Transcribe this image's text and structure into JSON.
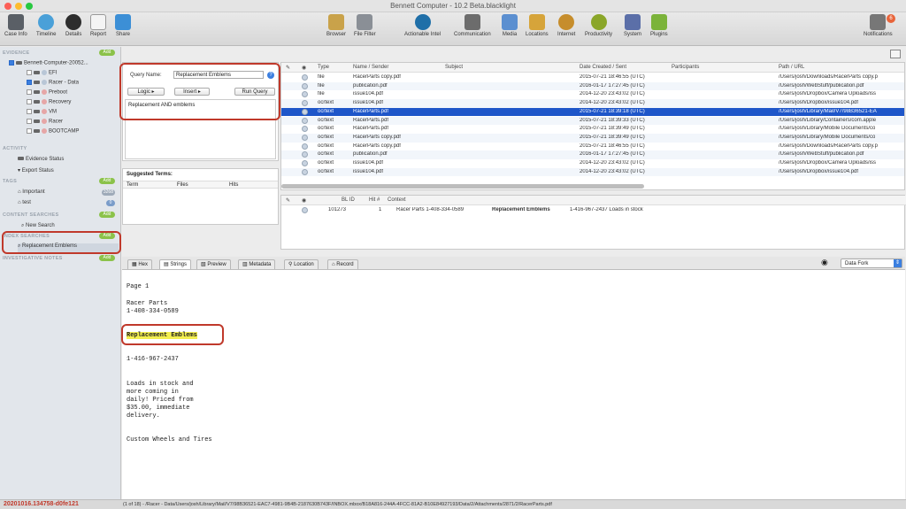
{
  "window": {
    "title": "Bennett Computer - 10.2 Beta.blacklight"
  },
  "toolbar": {
    "left": [
      {
        "label": "Case Info",
        "icon": "briefcase-icon"
      },
      {
        "label": "Timeline",
        "icon": "timeline-icon"
      },
      {
        "label": "Details",
        "icon": "details-icon"
      },
      {
        "label": "Report",
        "icon": "report-icon"
      },
      {
        "label": "Share",
        "icon": "share-icon"
      }
    ],
    "center": [
      {
        "label": "Browser",
        "icon": "browser-icon"
      },
      {
        "label": "File Filter",
        "icon": "file-filter-icon"
      },
      {
        "label": "Actionable Intel",
        "icon": "actionable-intel-icon"
      },
      {
        "label": "Communication",
        "icon": "communication-icon"
      },
      {
        "label": "Media",
        "icon": "media-icon"
      },
      {
        "label": "Locations",
        "icon": "locations-icon"
      },
      {
        "label": "Internet",
        "icon": "internet-icon"
      },
      {
        "label": "Productivity",
        "icon": "productivity-icon"
      },
      {
        "label": "System",
        "icon": "system-icon"
      },
      {
        "label": "Plugins",
        "icon": "plugins-icon"
      }
    ],
    "right": {
      "label": "Notifications",
      "badge": "6"
    }
  },
  "sidebar": {
    "evidence": {
      "title": "EVIDENCE",
      "add": "Add",
      "root": "Bennett-Computer-20052...",
      "items": [
        "EFI",
        "Racer - Data",
        "Preboot",
        "Recovery",
        "VM",
        "Racer",
        "BOOTCAMP"
      ]
    },
    "activity": {
      "title": "ACTIVITY",
      "items": [
        "Evidence Status",
        "Export Status"
      ]
    },
    "tags": {
      "title": "TAGS",
      "add": "Add",
      "items": [
        {
          "label": "Important",
          "count": "3268"
        },
        {
          "label": "test",
          "count": "0"
        }
      ]
    },
    "content": {
      "title": "CONTENT SEARCHES",
      "add": "Add",
      "items": [
        "New Search"
      ]
    },
    "index": {
      "title": "INDEX SEARCHES",
      "add": "Add",
      "items": [
        "Replacement Emblems"
      ]
    },
    "notes": {
      "title": "INVESTIGATIVE NOTES",
      "add": "Add"
    }
  },
  "query": {
    "name_label": "Query Name:",
    "name_value": "Replacement Emblems",
    "logic": "Logic",
    "insert": "Insert",
    "run": "Run Query",
    "text": "Replacement AND emblems",
    "suggested_title": "Suggested Terms:",
    "cols": [
      "Term",
      "Files",
      "Hits"
    ]
  },
  "results": {
    "cols": [
      "Type",
      "Name / Sender",
      "Subject",
      "Date Created / Sent",
      "Participants",
      "Path / URL"
    ],
    "rows": [
      [
        "file",
        "RacerParts copy.pdf",
        "",
        "2015-07-21 18:46:55 (UTC)",
        "",
        "/Users/josh/Downloads/RacerParts copy.p"
      ],
      [
        "file",
        "publication.pdf",
        "",
        "2016-01-17 17:27:45 (UTC)",
        "",
        "/Users/josh/WebStuff/publication.pdf"
      ],
      [
        "file",
        "issue104.pdf",
        "",
        "2014-12-20 23:43:02 (UTC)",
        "",
        "/Users/josh/Dropbox/Camera Uploads/iss"
      ],
      [
        "ocrtext",
        "issue104.pdf",
        "",
        "2014-12-20 23:43:02 (UTC)",
        "",
        "/Users/josh/Dropbox/issue104.pdf"
      ],
      [
        "ocrtext",
        "RacerParts.pdf",
        "",
        "2015-07-21 18:39:18 (UTC)",
        "",
        "/Users/josh/Library/Mail/V7/98B36521-EA"
      ],
      [
        "ocrtext",
        "RacerParts.pdf",
        "",
        "2015-07-21 18:39:33 (UTC)",
        "",
        "/Users/josh/Library/Containers/com.apple"
      ],
      [
        "ocrtext",
        "RacerParts.pdf",
        "",
        "2015-07-21 18:39:49 (UTC)",
        "",
        "/Users/josh/Library/Mobile Documents/co"
      ],
      [
        "ocrtext",
        "RacerParts copy.pdf",
        "",
        "2015-07-21 18:39:49 (UTC)",
        "",
        "/Users/josh/Library/Mobile Documents/co"
      ],
      [
        "ocrtext",
        "RacerParts copy.pdf",
        "",
        "2015-07-21 18:46:55 (UTC)",
        "",
        "/Users/josh/Downloads/RacerParts copy.p"
      ],
      [
        "ocrtext",
        "publication.pdf",
        "",
        "2016-01-17 17:27:45 (UTC)",
        "",
        "/Users/josh/WebStuff/publication.pdf"
      ],
      [
        "ocrtext",
        "issue104.pdf",
        "",
        "2014-12-20 23:43:02 (UTC)",
        "",
        "/Users/josh/Dropbox/Camera Uploads/iss"
      ],
      [
        "ocrtext",
        "issue104.pdf",
        "",
        "2014-12-20 23:43:02 (UTC)",
        "",
        "/Users/josh/Dropbox/issue104.pdf"
      ]
    ]
  },
  "hits": {
    "cols": [
      "BL ID",
      "Hit #",
      "Context"
    ],
    "row": {
      "id": "101273",
      "hit": "1",
      "pre": "Racer Parts  1-408-334-0589",
      "term": "Replacement Emblems",
      "post": "1-416-967-2437    Loads in stock"
    }
  },
  "tabs": [
    "Hex",
    "Strings",
    "Preview",
    "Metadata",
    "Location",
    "Record"
  ],
  "viewer": {
    "fork": "Data Fork",
    "lines": [
      "Page 1",
      "Racer Parts",
      "1-408-334-0589",
      "Replacement Emblems",
      "1-416-967-2437",
      "Loads in stock and",
      "more coming in",
      "daily! Priced from",
      "$35.00, immediate",
      "delivery.",
      "Custom Wheels and Tires"
    ]
  },
  "status": {
    "left": "20201016.134758-d0fe121",
    "path": "(1 of 18)  - /Racer - Data/Users/josh/Library/Mail/V7/98B36521-EAC7-4981-9B4B-2187630B743F/INBOX.mbox/B18A816-244A-4FCC-81A2-B10E84927193/Data/2/Attachments/2871/2/RacerParts.pdf"
  }
}
